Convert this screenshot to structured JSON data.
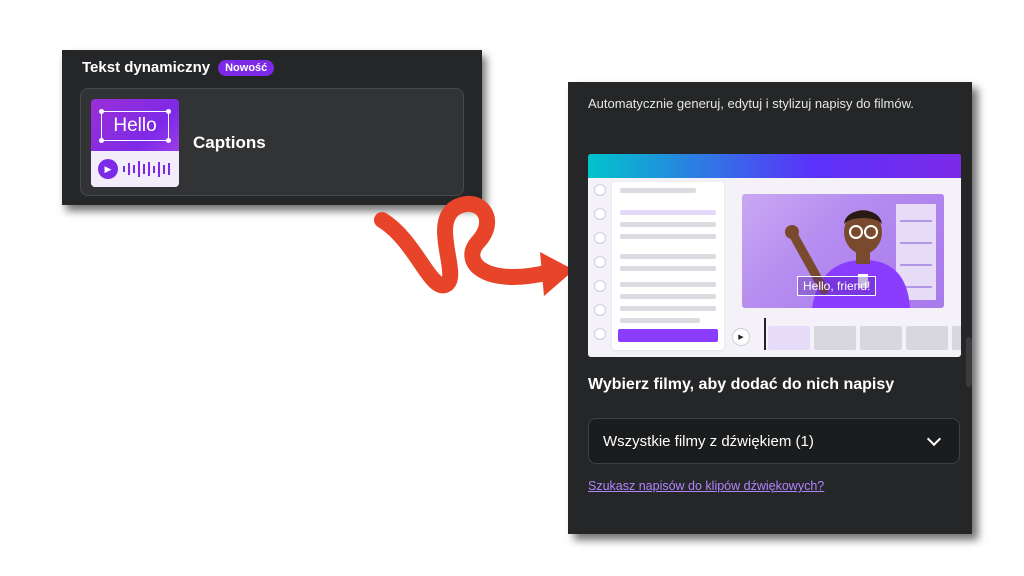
{
  "left_panel": {
    "section_title": "Tekst dynamiczny",
    "badge": "Nowość",
    "card": {
      "label": "Captions",
      "thumb_text": "Hello",
      "icon": "play-icon"
    }
  },
  "right_panel": {
    "description": "Automatycznie generuj, edytuj i stylizuj napisy do filmów.",
    "illustration": {
      "caption_text": "Hello, friend!"
    },
    "heading": "Wybierz filmy, aby dodać do nich napisy",
    "select": {
      "value": "Wszystkie filmy z dźwiękiem (1)",
      "icon": "chevron-down-icon"
    },
    "link": "Szukasz napisów do klipów dźwiękowych?"
  },
  "colors": {
    "panel_bg": "#252627",
    "accent": "#7d2ae8",
    "link": "#b384ff",
    "arrow": "#e8442a"
  }
}
